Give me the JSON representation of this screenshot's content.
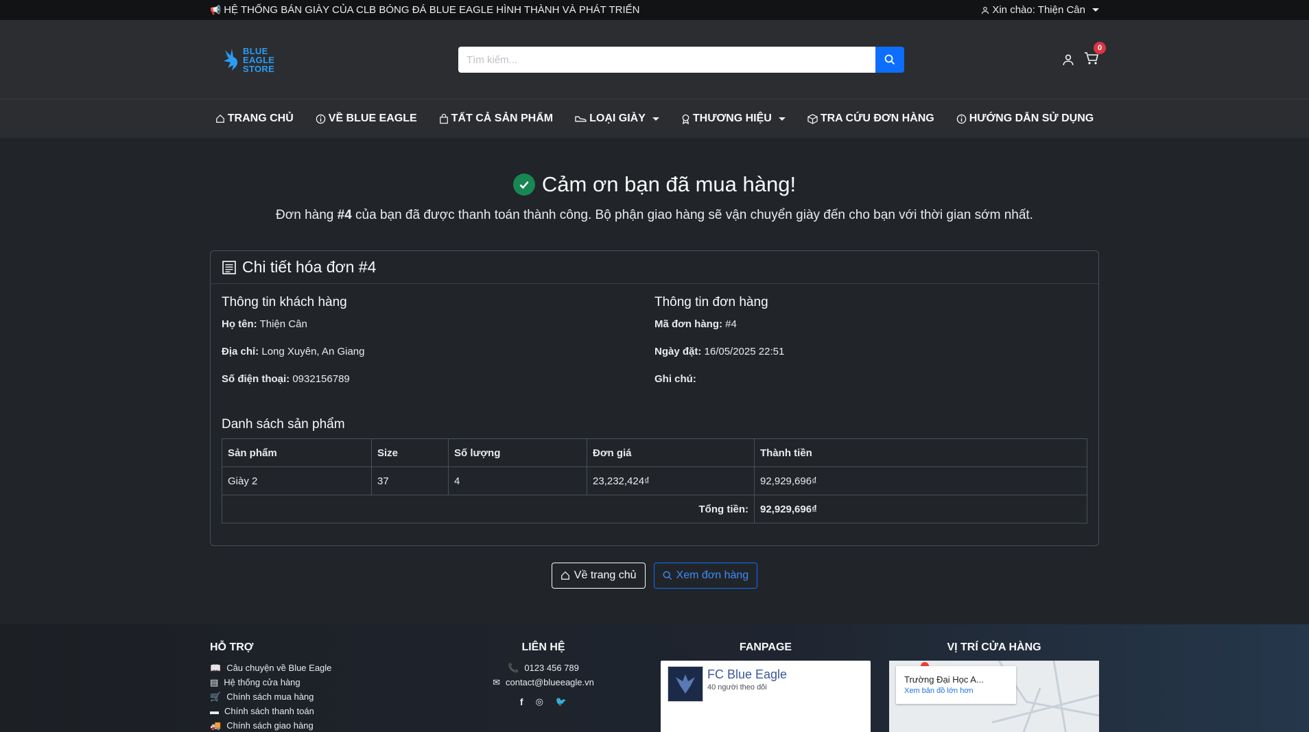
{
  "topbar": {
    "announcement": "HỆ THỐNG BÁN GIÀY CỦA CLB BÓNG ĐÁ BLUE EAGLE HÌNH THÀNH VÀ PHÁT TRIỂN",
    "greeting": "Xin chào: Thiện Cân"
  },
  "header": {
    "logo_line1": "BLUE",
    "logo_line2": "EAGLE",
    "logo_line3": "STORE",
    "search_placeholder": "Tìm kiếm...",
    "cart_count": "0"
  },
  "nav": {
    "items": [
      {
        "label": "TRANG CHỦ",
        "icon": "home-icon"
      },
      {
        "label": "VỀ BLUE EAGLE",
        "icon": "info-icon"
      },
      {
        "label": "TẤT CẢ SẢN PHẨM",
        "icon": "bag-icon"
      },
      {
        "label": "LOẠI GIÀY",
        "icon": "shoe-icon"
      },
      {
        "label": "THƯƠNG HIỆU",
        "icon": "award-icon"
      },
      {
        "label": "TRA CỨU ĐƠN HÀNG",
        "icon": "box-icon"
      },
      {
        "label": "HƯỚNG DẪN SỬ DỤNG",
        "icon": "info-icon"
      }
    ]
  },
  "thanks": {
    "title": "Cảm ơn bạn đã mua hàng!",
    "msg_prefix": "Đơn hàng ",
    "order_ref": "#4",
    "msg_suffix": " của bạn đã được thanh toán thành công. Bộ phận giao hàng sẽ vận chuyển giày đến cho bạn với thời gian sớm nhất."
  },
  "invoice": {
    "title": "Chi tiết hóa đơn #4",
    "customer": {
      "heading": "Thông tin khách hàng",
      "name_label": "Họ tên:",
      "name": "Thiện Cân",
      "address_label": "Địa chỉ:",
      "address": "Long Xuyên, An Giang",
      "phone_label": "Số điện thoại:",
      "phone": "0932156789"
    },
    "order": {
      "heading": "Thông tin đơn hàng",
      "code_label": "Mã đơn hàng:",
      "code": "#4",
      "date_label": "Ngày đặt:",
      "date": "16/05/2025 22:51",
      "note_label": "Ghi chú:",
      "note": ""
    },
    "products_heading": "Danh sách sản phẩm",
    "columns": [
      "Sản phẩm",
      "Size",
      "Số lượng",
      "Đơn giá",
      "Thành tiền"
    ],
    "rows": [
      [
        "Giày 2",
        "37",
        "4",
        "23,232,424₫",
        "92,929,696₫"
      ]
    ],
    "total_label": "Tổng tiền:",
    "total": "92,929,696₫"
  },
  "actions": {
    "home": "Về trang chủ",
    "view_orders": "Xem đơn hàng"
  },
  "footer": {
    "support_title": "HỖ TRỢ",
    "support_links": [
      {
        "label": "Câu chuyện về Blue Eagle",
        "icon": "book-icon"
      },
      {
        "label": "Hệ thống cửa hàng",
        "icon": "store-icon"
      },
      {
        "label": "Chính sách mua hàng",
        "icon": "cart-icon"
      },
      {
        "label": "Chính sách thanh toán",
        "icon": "card-icon"
      },
      {
        "label": "Chính sách giao hàng",
        "icon": "truck-icon"
      }
    ],
    "contact_title": "LIÊN HỆ",
    "phone": "0123 456 789",
    "email": "contact@blueeagle.vn",
    "fanpage_title": "FANPAGE",
    "fanpage_name": "FC Blue Eagle",
    "fanpage_followers": "40 người theo dõi",
    "location_title": "VỊ TRÍ CỬA HÀNG",
    "map_place": "Trường Đại Học A...",
    "map_link": "Xem bản đồ lớn hơn"
  }
}
